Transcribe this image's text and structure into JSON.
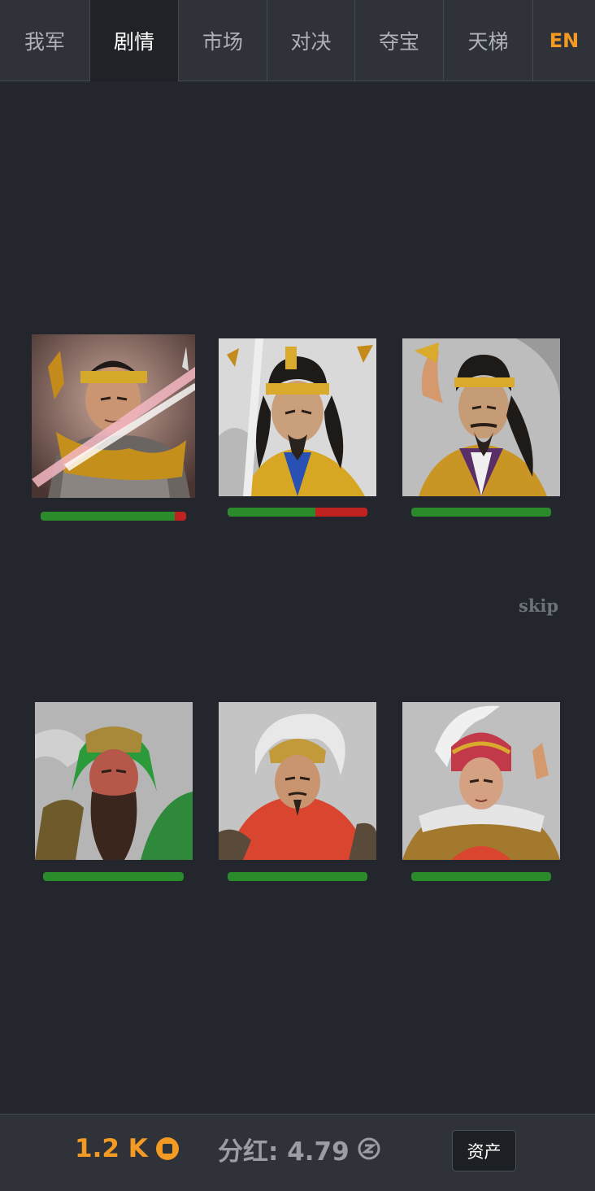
{
  "nav": {
    "tabs": [
      {
        "label": "我军",
        "active": false
      },
      {
        "label": "剧情",
        "active": true
      },
      {
        "label": "市场",
        "active": false
      },
      {
        "label": "对决",
        "active": false
      },
      {
        "label": "夺宝",
        "active": false
      },
      {
        "label": "天梯",
        "active": false
      }
    ],
    "language": "EN"
  },
  "battle": {
    "enemy_team": [
      {
        "portrait": "yellow-turban-warrior-portrait",
        "hp_fraction": 0.92,
        "hit_effect": "slash-effect"
      },
      {
        "portrait": "yellow-turban-swordsman-portrait",
        "hp_fraction": 0.63
      },
      {
        "portrait": "yellow-turban-sorcerer-portrait",
        "hp_fraction": 1.0
      }
    ],
    "player_team": [
      {
        "portrait": "green-robed-bearded-general-portrait",
        "hp_fraction": 1.0
      },
      {
        "portrait": "red-caped-gold-helmet-general-portrait",
        "hp_fraction": 1.0
      },
      {
        "portrait": "white-plumed-young-general-portrait",
        "hp_fraction": 1.0
      }
    ],
    "skip_label": "skip"
  },
  "footer": {
    "coin_amount": "1.2 K",
    "coin_icon": "coin-icon",
    "dividend_label": "分红: 4.79",
    "dividend_icon": "dividend-token-icon",
    "assets_button": "资产"
  },
  "colors": {
    "accent": "#f39a25",
    "hp_green": "#2a8a2c",
    "hp_red": "#c0231f",
    "background": "#23272d"
  }
}
